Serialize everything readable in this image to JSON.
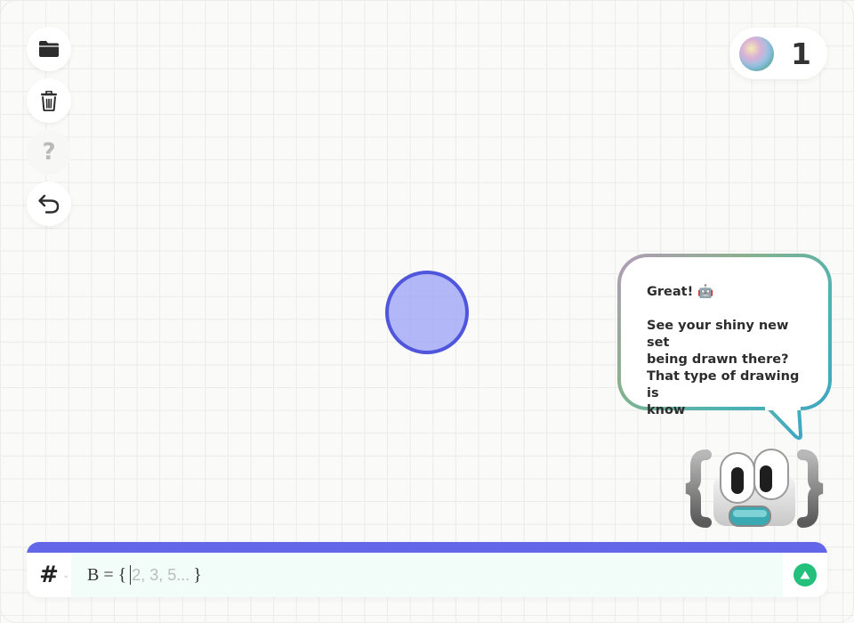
{
  "toolbar": {
    "help_label": "?"
  },
  "score": {
    "value": "1"
  },
  "bubble": {
    "text": "Great! 🤖\n\nSee your shiny new set\nbeing drawn there?\nThat type of drawing is\nknow"
  },
  "input": {
    "prefix_symbol": "#",
    "expression_prefix": "B = {",
    "placeholder": "2, 3, 5...",
    "expression_suffix": "}"
  },
  "colors": {
    "set_fill": "#9ca4f6",
    "set_stroke": "#5056dc",
    "input_accent": "#6466ea",
    "send_button": "#22c07a",
    "input_field_bg": "#f2fdf9"
  },
  "icons": [
    "folder-icon",
    "trash-icon",
    "help-icon",
    "undo-icon",
    "orb-icon",
    "send-icon",
    "mascot-icon"
  ]
}
